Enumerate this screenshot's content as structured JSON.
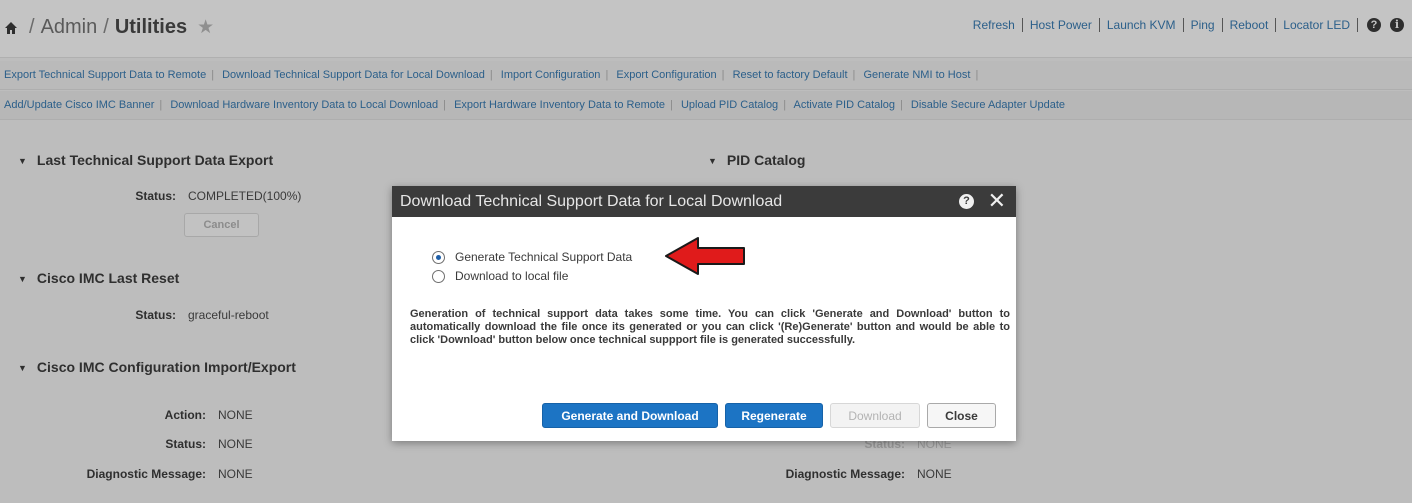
{
  "header": {
    "breadcrumb": [
      "Admin",
      "Utilities"
    ],
    "actions": [
      "Refresh",
      "Host Power",
      "Launch KVM",
      "Ping",
      "Reboot",
      "Locator LED"
    ],
    "help_glyph": "?",
    "info_glyph": "i",
    "icons": [
      "home-icon",
      "star-icon",
      "help-icon",
      "info-icon"
    ]
  },
  "link_rows": {
    "row1": [
      "Export Technical Support Data to Remote",
      "Download Technical Support Data for Local Download",
      "Import Configuration",
      "Export Configuration",
      "Reset to factory Default",
      "Generate NMI to Host"
    ],
    "row2": [
      "Add/Update Cisco IMC Banner",
      "Download Hardware Inventory Data to Local Download",
      "Export Hardware Inventory Data to Remote",
      "Upload PID Catalog",
      "Activate PID Catalog",
      "Disable Secure Adapter Update"
    ]
  },
  "sections": {
    "last_export": {
      "title": "Last Technical Support Data Export",
      "status_label": "Status:",
      "status_value": "COMPLETED(100%)",
      "cancel_label": "Cancel"
    },
    "last_reset": {
      "title": "Cisco IMC Last Reset",
      "status_label": "Status:",
      "status_value": "graceful-reboot"
    },
    "config": {
      "title": "Cisco IMC Configuration Import/Export",
      "action_label": "Action:",
      "action_value": "NONE",
      "status_label": "Status:",
      "status_value": "NONE",
      "diag_label": "Diagnostic Message:",
      "diag_value": "NONE"
    },
    "pid_catalog": {
      "title": "PID Catalog",
      "status_label": "Status:",
      "status_value": "NONE",
      "diag_label": "Diagnostic Message:",
      "diag_value": "NONE"
    }
  },
  "modal": {
    "title": "Download Technical Support Data for Local Download",
    "help_glyph": "?",
    "close_glyph": "✕",
    "options": [
      {
        "label": "Generate Technical Support Data",
        "selected": true
      },
      {
        "label": "Download to local file",
        "selected": false
      }
    ],
    "description": "Generation of technical support data takes some time. You can click 'Generate and Download' button to automatically download the file once its generated or you can click '(Re)Generate' button and would be able to click 'Download' button below once technical suppport file is generated successfully.",
    "buttons": {
      "generate_download": "Generate and Download",
      "regenerate": "Regenerate",
      "download": "Download",
      "close": "Close"
    }
  },
  "colors": {
    "background": "#bdbdbd",
    "link": "#2b5f8a",
    "primary_button": "#1c74c4",
    "modal_header": "#3b3b3b",
    "arrow": "#e01b1b"
  }
}
